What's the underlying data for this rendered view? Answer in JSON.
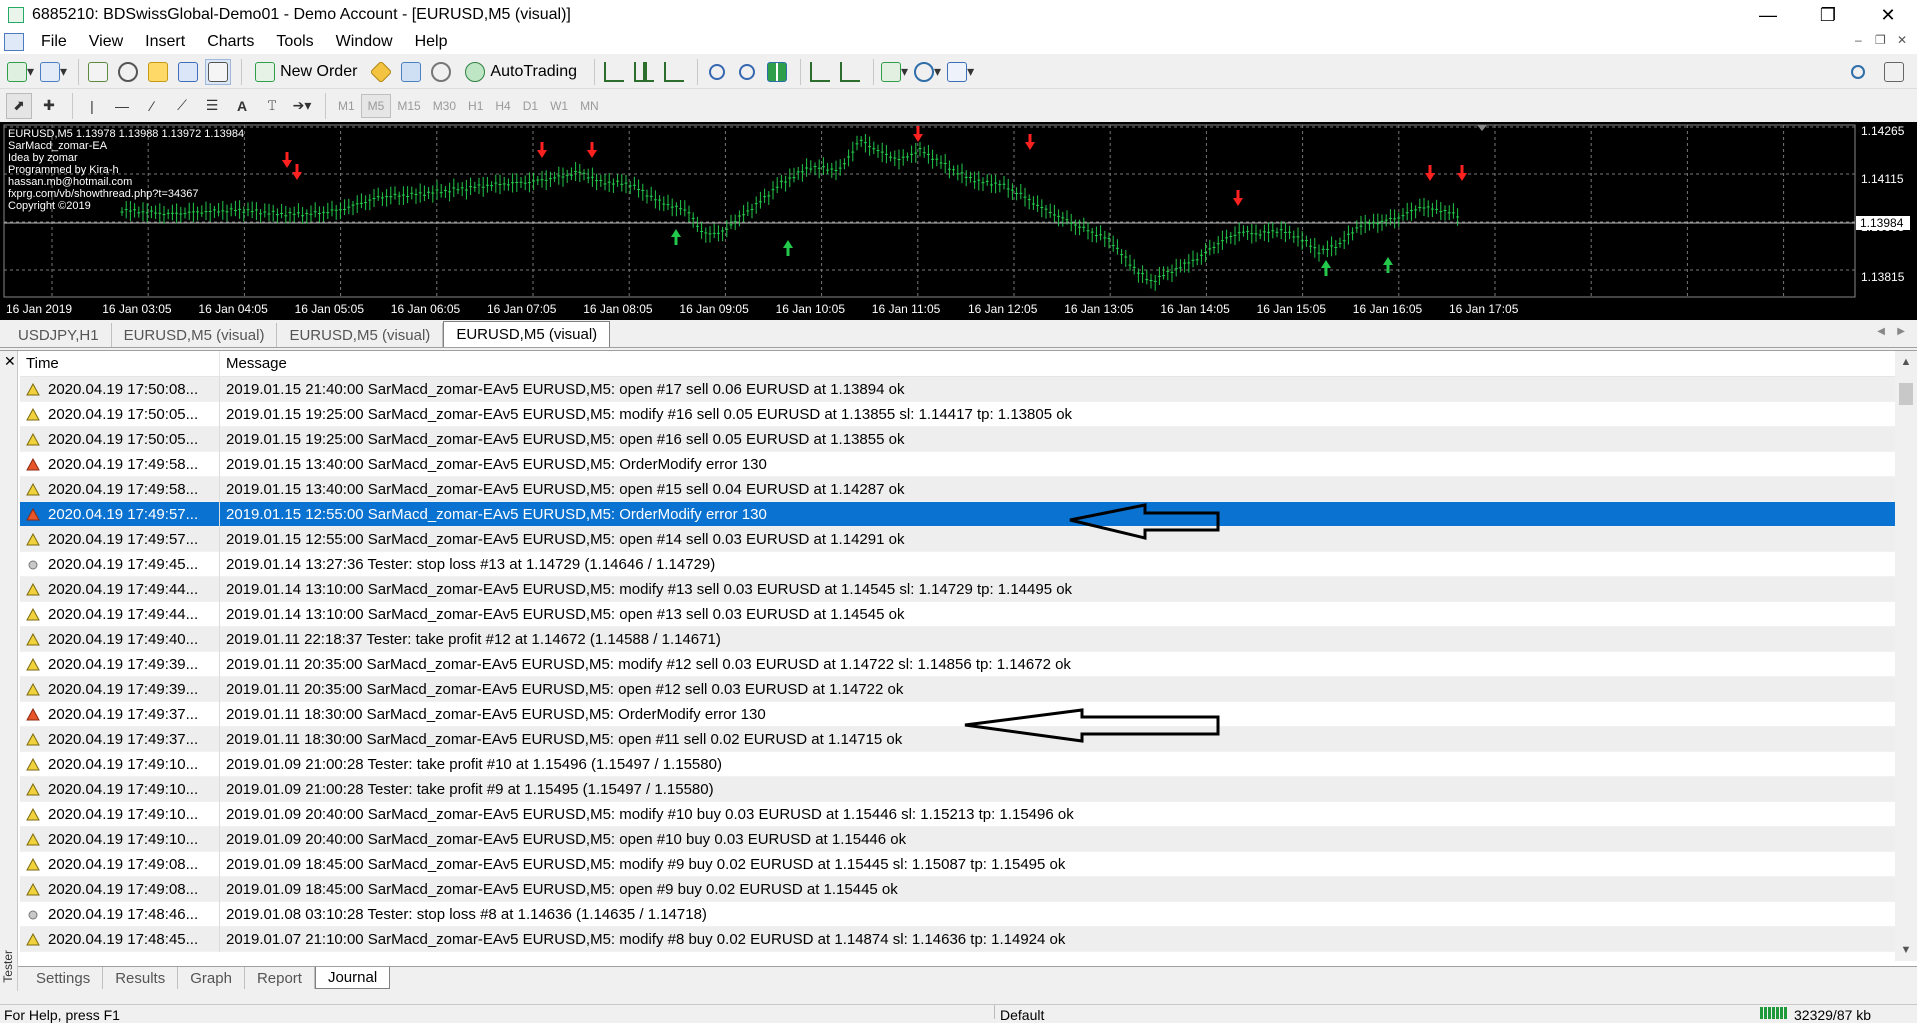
{
  "window": {
    "title": "6885210: BDSwissGlobal-Demo01 - Demo Account - [EURUSD,M5 (visual)]"
  },
  "menu": {
    "items": [
      "File",
      "View",
      "Insert",
      "Charts",
      "Tools",
      "Window",
      "Help"
    ]
  },
  "toolbar": {
    "new_order": "New Order",
    "autotrading": "AutoTrading"
  },
  "periods": [
    "M1",
    "M5",
    "M15",
    "M30",
    "H1",
    "H4",
    "D1",
    "W1",
    "MN"
  ],
  "chart": {
    "info_lines": [
      "EURUSD,M5  1.13978 1.13988 1.13972 1.13984",
      "SarMacd_zomar-EA",
      "Idea by zomar",
      "Programmed by Kira-h",
      "hassan.mb@hotmail.com",
      "fxprg.com/vb/showthread.php?t=34367",
      "Copyright ©2019"
    ],
    "price_labels": [
      "1.14265",
      "1.14115",
      "1.13965",
      "1.13815"
    ],
    "current_price": "1.13984",
    "time_labels": [
      "16 Jan 2019",
      "16 Jan 03:05",
      "16 Jan 04:05",
      "16 Jan 05:05",
      "16 Jan 06:05",
      "16 Jan 07:05",
      "16 Jan 08:05",
      "16 Jan 09:05",
      "16 Jan 10:05",
      "16 Jan 11:05",
      "16 Jan 12:05",
      "16 Jan 13:05",
      "16 Jan 14:05",
      "16 Jan 15:05",
      "16 Jan 16:05",
      "16 Jan 17:05"
    ]
  },
  "chart_tabs": [
    "USDJPY,H1",
    "EURUSD,M5 (visual)",
    "EURUSD,M5 (visual)",
    "EURUSD,M5 (visual)"
  ],
  "journal": {
    "headers": {
      "time": "Time",
      "message": "Message"
    },
    "rows": [
      {
        "level": "warn",
        "time": "2020.04.19 17:50:08...",
        "message": "2019.01.15 21:40:00  SarMacd_zomar-EAv5 EURUSD,M5: open #17 sell 0.06 EURUSD at 1.13894 ok"
      },
      {
        "level": "warn",
        "time": "2020.04.19 17:50:05...",
        "message": "2019.01.15 19:25:00  SarMacd_zomar-EAv5 EURUSD,M5: modify #16 sell 0.05 EURUSD at 1.13855 sl: 1.14417 tp: 1.13805 ok"
      },
      {
        "level": "warn",
        "time": "2020.04.19 17:50:05...",
        "message": "2019.01.15 19:25:00  SarMacd_zomar-EAv5 EURUSD,M5: open #16 sell 0.05 EURUSD at 1.13855 ok"
      },
      {
        "level": "error",
        "time": "2020.04.19 17:49:58...",
        "message": "2019.01.15 13:40:00  SarMacd_zomar-EAv5 EURUSD,M5: OrderModify error 130"
      },
      {
        "level": "warn",
        "time": "2020.04.19 17:49:58...",
        "message": "2019.01.15 13:40:00  SarMacd_zomar-EAv5 EURUSD,M5: open #15 sell 0.04 EURUSD at 1.14287 ok"
      },
      {
        "level": "error",
        "time": "2020.04.19 17:49:57...",
        "message": "2019.01.15 12:55:00  SarMacd_zomar-EAv5 EURUSD,M5: OrderModify error 130",
        "selected": true
      },
      {
        "level": "warn",
        "time": "2020.04.19 17:49:57...",
        "message": "2019.01.15 12:55:00  SarMacd_zomar-EAv5 EURUSD,M5: open #14 sell 0.03 EURUSD at 1.14291 ok"
      },
      {
        "level": "info",
        "time": "2020.04.19 17:49:45...",
        "message": "2019.01.14 13:27:36  Tester: stop loss #13 at 1.14729 (1.14646 / 1.14729)"
      },
      {
        "level": "warn",
        "time": "2020.04.19 17:49:44...",
        "message": "2019.01.14 13:10:00  SarMacd_zomar-EAv5 EURUSD,M5: modify #13 sell 0.03 EURUSD at 1.14545 sl: 1.14729 tp: 1.14495 ok"
      },
      {
        "level": "warn",
        "time": "2020.04.19 17:49:44...",
        "message": "2019.01.14 13:10:00  SarMacd_zomar-EAv5 EURUSD,M5: open #13 sell 0.03 EURUSD at 1.14545 ok"
      },
      {
        "level": "warn",
        "time": "2020.04.19 17:49:40...",
        "message": "2019.01.11 22:18:37  Tester: take profit #12 at 1.14672 (1.14588 / 1.14671)"
      },
      {
        "level": "warn",
        "time": "2020.04.19 17:49:39...",
        "message": "2019.01.11 20:35:00  SarMacd_zomar-EAv5 EURUSD,M5: modify #12 sell 0.03 EURUSD at 1.14722 sl: 1.14856 tp: 1.14672 ok"
      },
      {
        "level": "warn",
        "time": "2020.04.19 17:49:39...",
        "message": "2019.01.11 20:35:00  SarMacd_zomar-EAv5 EURUSD,M5: open #12 sell 0.03 EURUSD at 1.14722 ok"
      },
      {
        "level": "error",
        "time": "2020.04.19 17:49:37...",
        "message": "2019.01.11 18:30:00  SarMacd_zomar-EAv5 EURUSD,M5: OrderModify error 130"
      },
      {
        "level": "warn",
        "time": "2020.04.19 17:49:37...",
        "message": "2019.01.11 18:30:00  SarMacd_zomar-EAv5 EURUSD,M5: open #11 sell 0.02 EURUSD at 1.14715 ok"
      },
      {
        "level": "warn",
        "time": "2020.04.19 17:49:10...",
        "message": "2019.01.09 21:00:28  Tester: take profit #10 at 1.15496 (1.15497 / 1.15580)"
      },
      {
        "level": "warn",
        "time": "2020.04.19 17:49:10...",
        "message": "2019.01.09 21:00:28  Tester: take profit #9 at 1.15495 (1.15497 / 1.15580)"
      },
      {
        "level": "warn",
        "time": "2020.04.19 17:49:10...",
        "message": "2019.01.09 20:40:00  SarMacd_zomar-EAv5 EURUSD,M5: modify #10 buy 0.03 EURUSD at 1.15446 sl: 1.15213 tp: 1.15496 ok"
      },
      {
        "level": "warn",
        "time": "2020.04.19 17:49:10...",
        "message": "2019.01.09 20:40:00  SarMacd_zomar-EAv5 EURUSD,M5: open #10 buy 0.03 EURUSD at 1.15446 ok"
      },
      {
        "level": "warn",
        "time": "2020.04.19 17:49:08...",
        "message": "2019.01.09 18:45:00  SarMacd_zomar-EAv5 EURUSD,M5: modify #9 buy 0.02 EURUSD at 1.15445 sl: 1.15087 tp: 1.15495 ok"
      },
      {
        "level": "warn",
        "time": "2020.04.19 17:49:08...",
        "message": "2019.01.09 18:45:00  SarMacd_zomar-EAv5 EURUSD,M5: open #9 buy 0.02 EURUSD at 1.15445 ok"
      },
      {
        "level": "info",
        "time": "2020.04.19 17:48:46...",
        "message": "2019.01.08 03:10:28  Tester: stop loss #8 at 1.14636 (1.14635 / 1.14718)"
      },
      {
        "level": "warn",
        "time": "2020.04.19 17:48:45...",
        "message": "2019.01.07 21:10:00  SarMacd_zomar-EAv5 EURUSD,M5: modify #8 buy 0.02 EURUSD at 1.14874 sl: 1.14636 tp: 1.14924 ok"
      }
    ]
  },
  "bottom_tabs": [
    "Settings",
    "Results",
    "Graph",
    "Report",
    "Journal"
  ],
  "side_label": "Tester",
  "status": {
    "help": "For Help, press F1",
    "profile": "Default",
    "traffic": "32329/87 kb"
  },
  "colors": {
    "selected_row": "#0a72d1",
    "bull_arrow": "#22c94a",
    "bear_arrow": "#ff2020",
    "candles": "#22c94a"
  }
}
